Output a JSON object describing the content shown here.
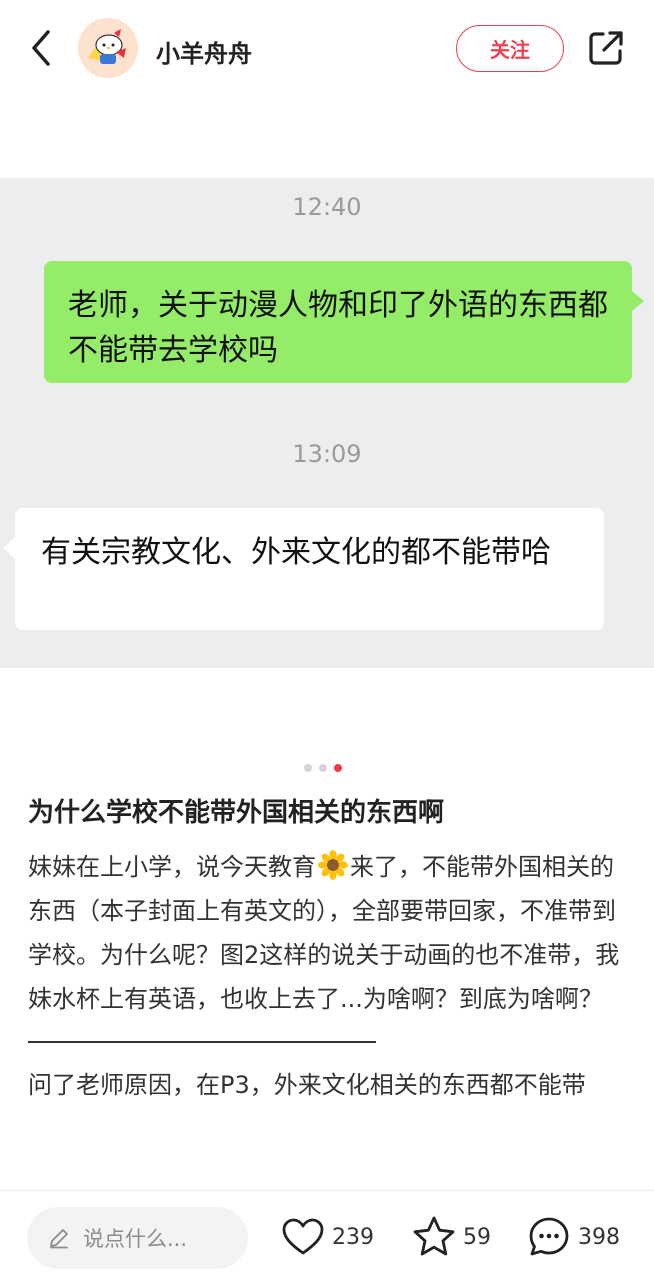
{
  "header": {
    "author_name": "小羊舟舟",
    "follow_label": "关注",
    "back_icon": "chevron-left-icon",
    "share_icon": "share-icon"
  },
  "chat": {
    "time_1": "12:40",
    "message_sent": "老师，关于动漫人物和印了外语的东西都不能带去学校吗",
    "time_2": "13:09",
    "message_received": "有关宗教文化、外来文化的都不能带哈"
  },
  "carousel": {
    "total": 3,
    "active_index": 3
  },
  "post": {
    "title": "为什么学校不能带外国相关的东西啊",
    "body_part1": "妹妹在上小学，说今天教育",
    "body_part2": "来了，不能带外国相关的东西（本子封面上有英文的），全部要带回家，不准带到学校。为什么呢？图2这样的说关于动画的也不准带，我妹水杯上有英语，也收上去了...为啥啊？到底为啥啊？",
    "body_part3": "问了老师原因，在P3，外来文化相关的东西都不能带"
  },
  "bottom_bar": {
    "comment_placeholder": "说点什么...",
    "likes": "239",
    "favorites": "59",
    "comments": "398"
  },
  "colors": {
    "accent": "#f04050",
    "sent_bubble": "#95ec69",
    "chat_bg": "#ededed"
  }
}
